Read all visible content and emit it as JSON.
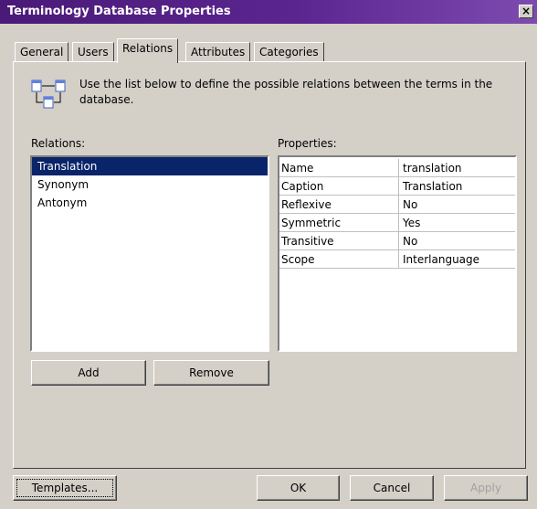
{
  "window": {
    "title": "Terminology Database Properties",
    "close": "×"
  },
  "tabs": [
    {
      "label": "General"
    },
    {
      "label": "Users"
    },
    {
      "label": "Relations"
    },
    {
      "label": "Attributes"
    },
    {
      "label": "Categories"
    }
  ],
  "info": {
    "text": "Use the list below to define the possible relations between the terms in the database."
  },
  "relations": {
    "label": "Relations:",
    "items": [
      "Translation",
      "Synonym",
      "Antonym"
    ],
    "selected": "Translation"
  },
  "properties": {
    "label": "Properties:",
    "rows": [
      {
        "name": "Name",
        "value": "translation"
      },
      {
        "name": "Caption",
        "value": "Translation"
      },
      {
        "name": "Reflexive",
        "value": "No"
      },
      {
        "name": "Symmetric",
        "value": "Yes"
      },
      {
        "name": "Transitive",
        "value": "No"
      },
      {
        "name": "Scope",
        "value": "Interlanguage"
      }
    ]
  },
  "buttons": {
    "add": "Add",
    "remove": "Remove",
    "templates": "Templates...",
    "ok": "OK",
    "cancel": "Cancel",
    "apply": "Apply"
  }
}
